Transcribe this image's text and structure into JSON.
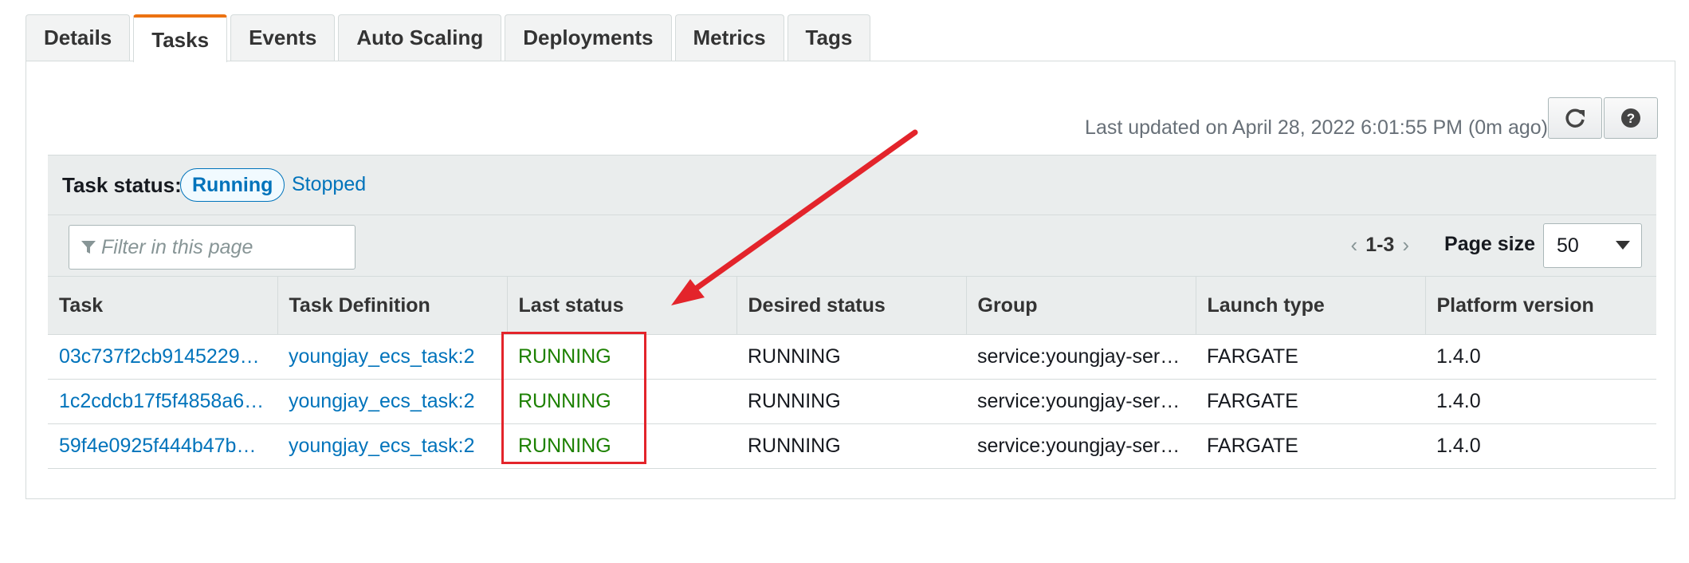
{
  "tabs": [
    {
      "label": "Details",
      "active": false
    },
    {
      "label": "Tasks",
      "active": true
    },
    {
      "label": "Events",
      "active": false
    },
    {
      "label": "Auto Scaling",
      "active": false
    },
    {
      "label": "Deployments",
      "active": false
    },
    {
      "label": "Metrics",
      "active": false
    },
    {
      "label": "Tags",
      "active": false
    }
  ],
  "toolbar": {
    "last_updated": "Last updated on April 28, 2022 6:01:55 PM (0m ago)",
    "refresh_icon": "refresh-icon",
    "help_icon": "help-icon"
  },
  "task_status": {
    "label": "Task status:",
    "running": "Running",
    "stopped": "Stopped"
  },
  "filter": {
    "placeholder": "Filter in this page",
    "icon": "filter-icon"
  },
  "pagination": {
    "range": "1-3",
    "page_size_label": "Page size",
    "page_size": "50"
  },
  "table": {
    "headers": [
      "Task",
      "Task Definition",
      "Last status",
      "Desired status",
      "Group",
      "Launch type",
      "Platform version"
    ],
    "rows": [
      [
        "03c737f2cb9145229…",
        "youngjay_ecs_task:2",
        "RUNNING",
        "RUNNING",
        "service:youngjay-ser…",
        "FARGATE",
        "1.4.0"
      ],
      [
        "1c2cdcb17f5f4858a6…",
        "youngjay_ecs_task:2",
        "RUNNING",
        "RUNNING",
        "service:youngjay-ser…",
        "FARGATE",
        "1.4.0"
      ],
      [
        "59f4e0925f444b47b4…",
        "youngjay_ecs_task:2",
        "RUNNING",
        "RUNNING",
        "service:youngjay-ser…",
        "FARGATE",
        "1.4.0"
      ]
    ]
  },
  "colors": {
    "link": "#0073bb",
    "running": "#1d8102",
    "active_tab_accent": "#ec7211",
    "annotation": "#e3242b"
  }
}
